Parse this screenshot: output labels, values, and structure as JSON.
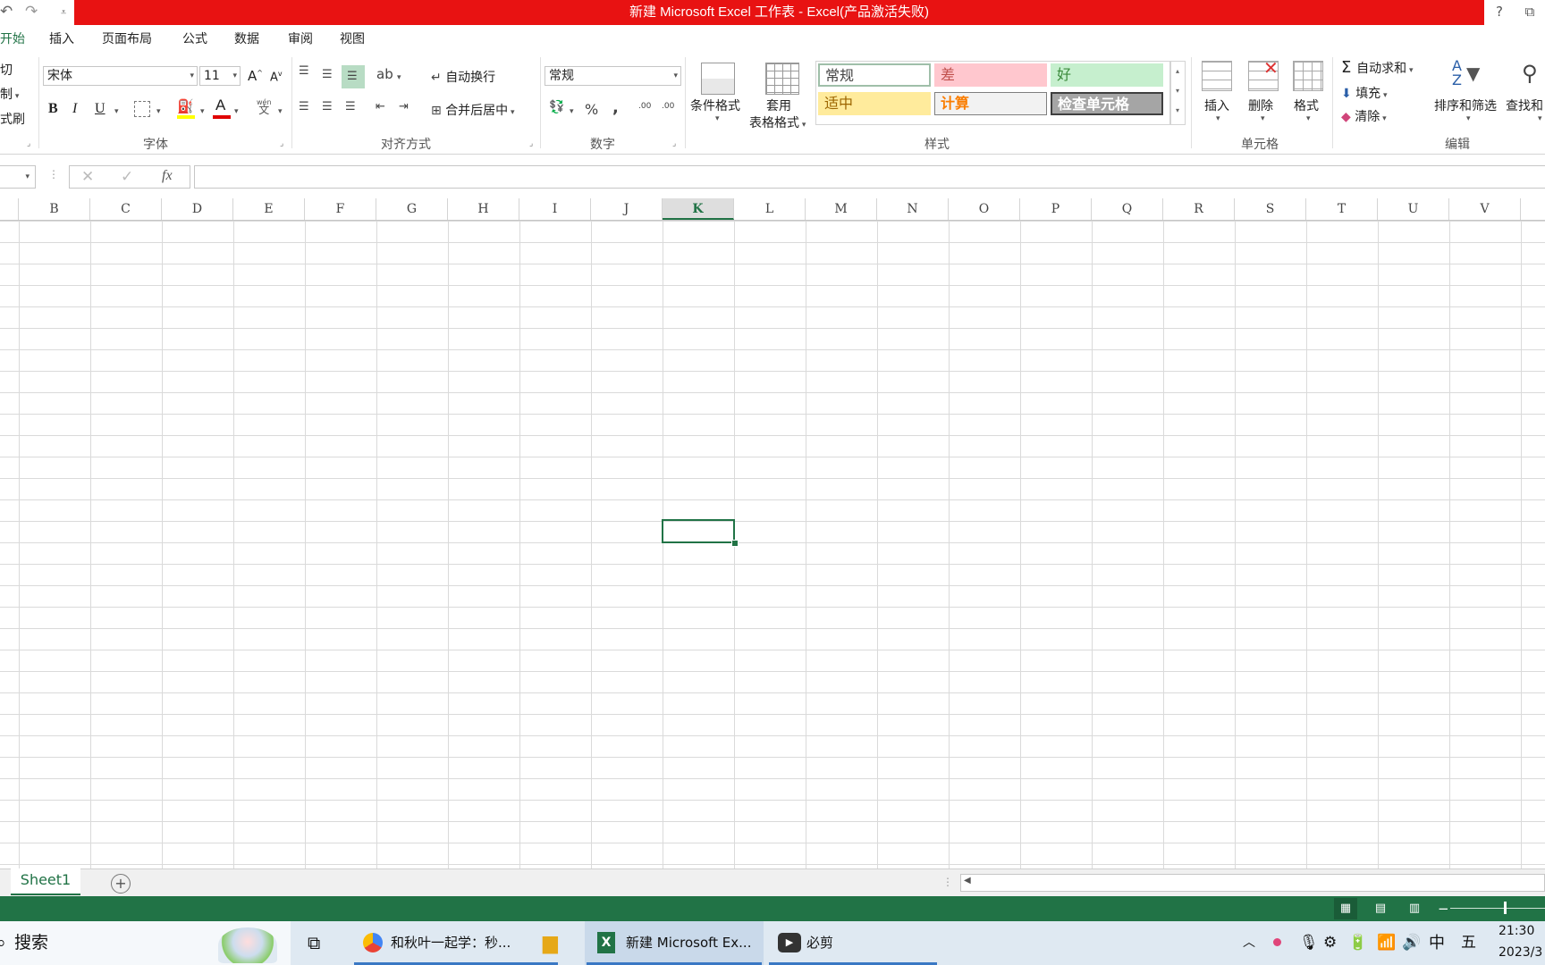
{
  "window": {
    "title": "新建 Microsoft Excel 工作表 -  Excel(产品激活失败)",
    "help_label": "?",
    "restore_label": "⧉"
  },
  "qat": {
    "undo": "↶",
    "redo": "↷",
    "customize": "⩡"
  },
  "tabs": [
    {
      "label": "开始",
      "active": true
    },
    {
      "label": "插入"
    },
    {
      "label": "页面布局"
    },
    {
      "label": "公式"
    },
    {
      "label": "数据"
    },
    {
      "label": "审阅"
    },
    {
      "label": "视图"
    }
  ],
  "clipboard": {
    "cut": "剪切",
    "copy": "复制",
    "painter": "格式刷"
  },
  "font": {
    "name": "宋体",
    "size": "11",
    "grow": "A",
    "shrink": "A",
    "bold": "B",
    "italic": "I",
    "underline": "U",
    "phonetic_top": "wén",
    "phonetic_bottom": "文",
    "group_label": "字体"
  },
  "alignment": {
    "wrap_label": "自动换行",
    "merge_label": "合并后居中",
    "group_label": "对齐方式"
  },
  "number": {
    "format": "常规",
    "percent": "%",
    "comma": ",",
    "inc_dec": ".00",
    "dec_dec": ".00",
    "group_label": "数字"
  },
  "styles": {
    "cond_format": "条件格式",
    "table_format_1": "套用",
    "table_format_2": "表格格式",
    "items": [
      {
        "label": "常规",
        "bg": "#ffffff",
        "color": "#444444",
        "border": "#9fbfa9"
      },
      {
        "label": "差",
        "bg": "#ffc7ce",
        "color": "#c0504d",
        "border": "#ffc7ce"
      },
      {
        "label": "好",
        "bg": "#c6efce",
        "color": "#3b8a3b",
        "border": "#c6efce"
      },
      {
        "label": "适中",
        "bg": "#ffeb9c",
        "color": "#9c6500",
        "border": "#ffeb9c"
      },
      {
        "label": "计算",
        "bg": "#f2f2f2",
        "color": "#fa7d00",
        "border": "#7f7f7f"
      },
      {
        "label": "检查单元格",
        "bg": "#a5a5a5",
        "color": "#ffffff",
        "border": "#3f3f3f"
      }
    ],
    "group_label": "样式"
  },
  "cells": {
    "insert": "插入",
    "delete": "删除",
    "format": "格式",
    "group_label": "单元格"
  },
  "editing": {
    "autosum": "自动求和",
    "fill": "填充",
    "clear": "清除",
    "sort": "排序和筛选",
    "find": "查找和",
    "group_label": "编辑"
  },
  "formula_bar": {
    "cancel": "✕",
    "enter": "✓",
    "fx": "fx",
    "value": ""
  },
  "columns": [
    "B",
    "C",
    "D",
    "E",
    "F",
    "G",
    "H",
    "I",
    "J",
    "K",
    "L",
    "M",
    "N",
    "O",
    "P",
    "Q",
    "R",
    "S",
    "T",
    "U",
    "V"
  ],
  "selected_column": "K",
  "sheet": {
    "tab": "Sheet1",
    "add": "+"
  },
  "taskbar": {
    "search": "搜索",
    "items": [
      {
        "label": "和秋叶一起学：秒..."
      },
      {
        "label": "新建 Microsoft Ex..."
      },
      {
        "label": "必剪"
      }
    ],
    "ime": "中",
    "ime2": "五",
    "time": "21:30",
    "date": "2023/3"
  }
}
